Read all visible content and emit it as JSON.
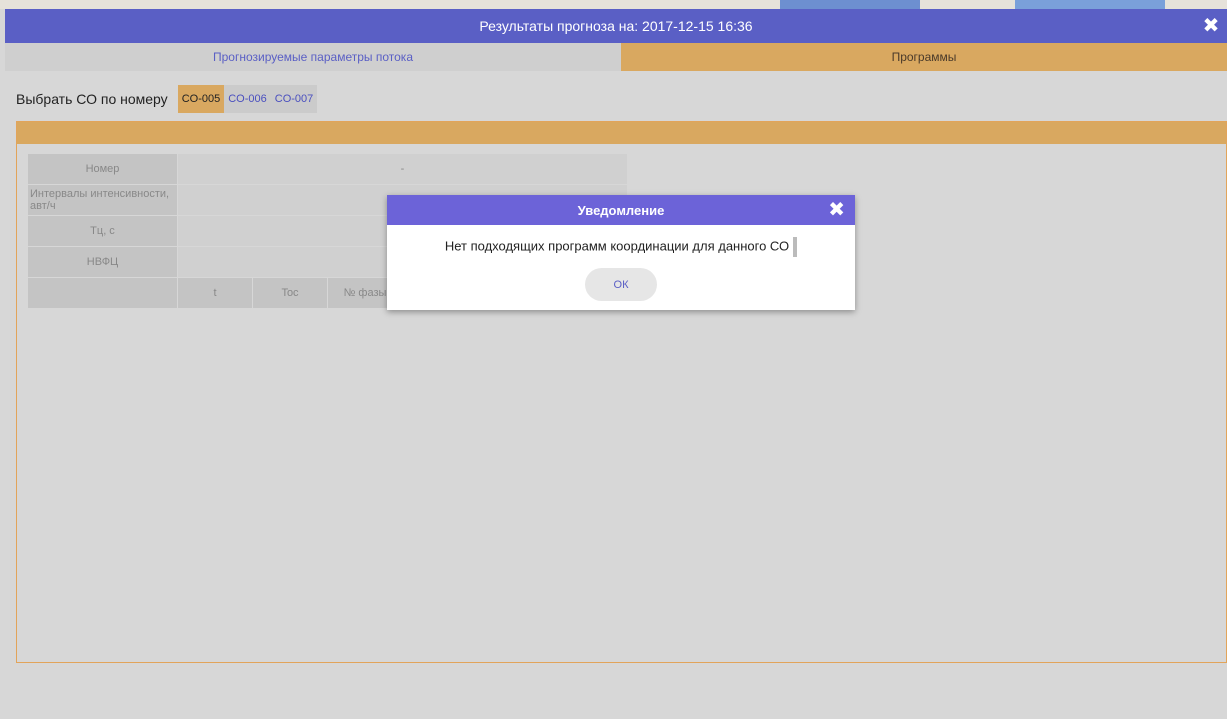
{
  "window": {
    "title": "Результаты прогноза на: 2017-12-15 16:36",
    "close_icon": "✖"
  },
  "tabs": [
    {
      "label": "Прогнозируемые параметры потока",
      "active": false
    },
    {
      "label": "Программы",
      "active": true
    }
  ],
  "co_picker": {
    "label": "Выбрать СО по номеру",
    "items": [
      "CO-005",
      "CO-006",
      "CO-007"
    ],
    "selected": "CO-005"
  },
  "params_table": {
    "rows": [
      {
        "header": "Номер",
        "value": "-"
      },
      {
        "header": "Интервалы интенсивности, авт/ч",
        "value": ""
      },
      {
        "header": "Тц, с",
        "value": ""
      },
      {
        "header": "НВФЦ",
        "value": ""
      }
    ],
    "phase_headers": [
      "",
      "t",
      "Toc",
      "№ фазы",
      "",
      "",
      ""
    ]
  },
  "dialog": {
    "title": "Уведомление",
    "close_icon": "✖",
    "message": "Нет подходящих программ координации для данного СО",
    "ok_label": "ОК"
  },
  "colors": {
    "titlebar": "#5a5fc5",
    "accent_orange": "#d9a860",
    "dialog_header": "#6c63d8"
  }
}
